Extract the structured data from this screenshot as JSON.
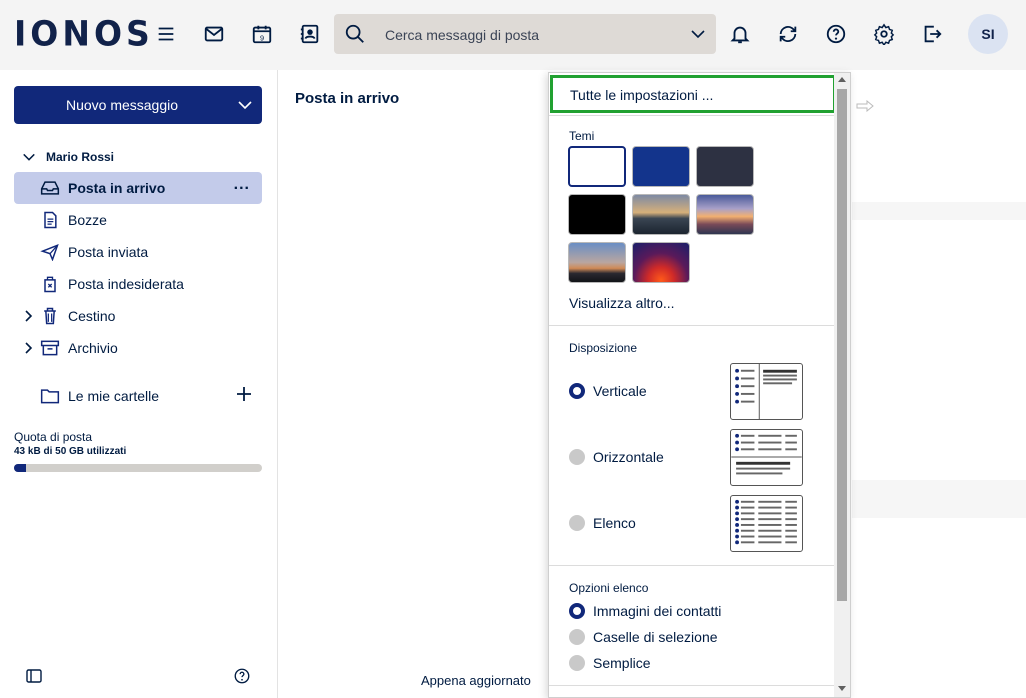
{
  "header": {
    "logo_text": "IONOS",
    "search_placeholder": "Cerca messaggi di posta",
    "calendar_day": "9",
    "avatar_initials": "SI",
    "icons": [
      "menu-icon",
      "mail-icon",
      "calendar-icon",
      "contacts-icon",
      "search-icon",
      "chevron-down-icon",
      "bell-icon",
      "refresh-icon",
      "help-icon",
      "gear-icon",
      "logout-icon"
    ]
  },
  "sidebar": {
    "compose_label": "Nuovo messaggio",
    "account_name": "Mario Rossi",
    "folders": [
      {
        "label": "Posta in arrivo",
        "icon": "inbox-icon",
        "active": true
      },
      {
        "label": "Bozze",
        "icon": "draft-icon"
      },
      {
        "label": "Posta inviata",
        "icon": "send-icon"
      },
      {
        "label": "Posta indesiderata",
        "icon": "spam-icon"
      },
      {
        "label": "Cestino",
        "icon": "trash-icon",
        "expandable": true
      },
      {
        "label": "Archivio",
        "icon": "archive-icon",
        "expandable": true
      }
    ],
    "my_folders_label": "Le mie cartelle",
    "quota_label": "Quota di posta",
    "quota_value": "43 kB di 50 GB utilizzati",
    "quota_fraction": 0.05,
    "more_icon": "..."
  },
  "main": {
    "title": "Posta in arrivo",
    "updated_label": "Appena aggiornato"
  },
  "settings_panel": {
    "all_settings_label": "Tutte le impostazioni ...",
    "themes_title": "Temi",
    "themes": [
      "white",
      "blue",
      "dark-slate",
      "black",
      "mountain-photo",
      "sunset-photo",
      "city-photo",
      "red-glow"
    ],
    "more_themes_label": "Visualizza altro...",
    "layout_title": "Disposizione",
    "layout_options": [
      {
        "label": "Verticale",
        "selected": true
      },
      {
        "label": "Orizzontale",
        "selected": false
      },
      {
        "label": "Elenco",
        "selected": false
      }
    ],
    "list_options_title": "Opzioni elenco",
    "list_options": [
      {
        "label": "Immagini dei contatti",
        "selected": true
      },
      {
        "label": "Caselle di selezione",
        "selected": false
      },
      {
        "label": "Semplice",
        "selected": false
      }
    ]
  },
  "colors": {
    "brand_navy": "#11287a",
    "highlight_green": "#21a131",
    "active_folder_bg": "#c3cbea"
  }
}
